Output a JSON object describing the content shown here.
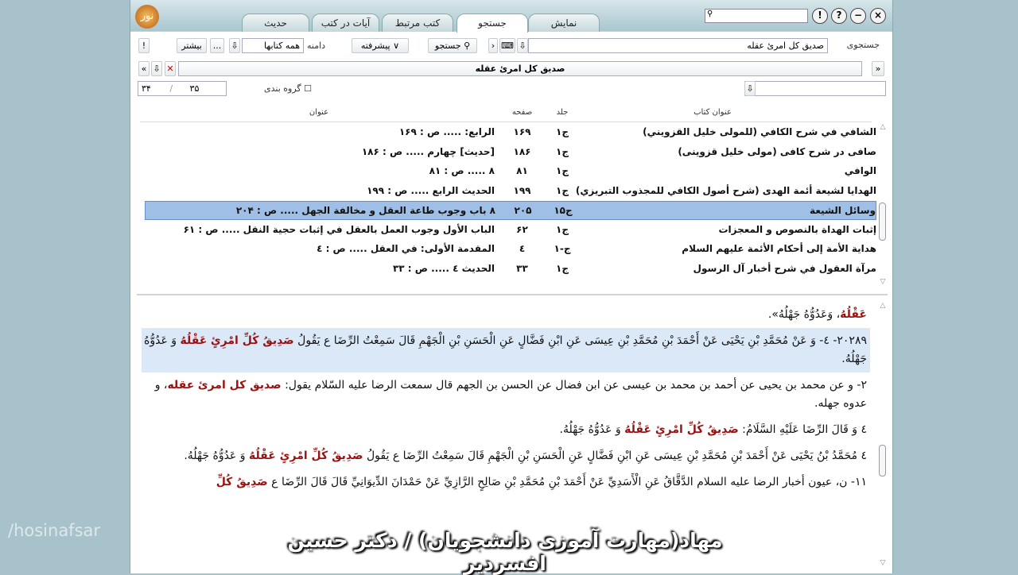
{
  "window": {
    "logo": "نور",
    "tabs": [
      "نمایش",
      "جستجو",
      "کتب مرتبط",
      "آیات در کتب",
      "حدیث"
    ],
    "active_tab": "جستجو",
    "controls": [
      "!",
      "?",
      "−",
      "×"
    ]
  },
  "toolbar": {
    "search_label": "جستجوی",
    "search_value": "صديق كل امرئ عقله",
    "search_button": "جستجو",
    "advanced_button": "پیشرفته",
    "scope_label": "دامنه",
    "scope_value": "همه کتابها",
    "more_dots": "...",
    "more_button": "بیشتر",
    "info": "!"
  },
  "filter_bar": {
    "query": "صديق كل امرئ عقله"
  },
  "paging": {
    "current": "۳۵",
    "separator": "/",
    "total": "۳۴",
    "grouping_label": "گروه بندی"
  },
  "table": {
    "headers": {
      "book": "عنوان کتاب",
      "volume": "جلد",
      "page": "صفحه",
      "title": "عنوان"
    },
    "rows": [
      {
        "book": "الشافي في شرح الكافي (للمولى خليل القزويني)",
        "volume": "ج۱",
        "page": "۱۶۹",
        "title": "الرابع: ..... ص : ۱۶۹"
      },
      {
        "book": "صافی در شرح کافی (مولی خلیل قزوینی)",
        "volume": "ج۱",
        "page": "۱۸۶",
        "title": "[حديث] چهارم ..... ص : ۱۸۶"
      },
      {
        "book": "الوافي",
        "volume": "ج۱",
        "page": "۸۱",
        "title": "۸ ..... ص : ۸۱"
      },
      {
        "book": "الهدايا لشيعة أئمة الهدى (شرح أصول الكافي للمجذوب التبريزي)",
        "volume": "ج۱",
        "page": "۱۹۹",
        "title": "الحديث الرابع ..... ص : ۱۹۹"
      },
      {
        "book": "وسائل الشيعة",
        "volume": "ج۱۵",
        "page": "۲۰۵",
        "title": "۸ باب وجوب طاعة العقل و مخالفة الجهل ..... ص : ۲۰۴"
      },
      {
        "book": "إثبات الهداة بالنصوص و المعجزات",
        "volume": "ج۱",
        "page": "۶۲",
        "title": "الباب الأول وجوب العمل بالعقل في إثبات حجية النقل ..... ص : ۶۱"
      },
      {
        "book": "هداية الأمة إلى أحكام الأئمة عليهم السلام",
        "volume": "ج-۱",
        "page": "٤",
        "title": "المقدمة الأولى: في العقل ..... ص : ٤"
      },
      {
        "book": "مرآة العقول في شرح أخبار آل الرسول",
        "volume": "ج۱",
        "page": "۳۳",
        "title": "الحديث ٤ ..... ص : ۳۳"
      }
    ],
    "selected_index": 4
  },
  "content": {
    "l1a": "عَقْلُهُ",
    "l1b": "، وَعَدُوُّهُ جَهْلُهُ».",
    "l2a": "۲۰۲۸۹- ٤- وَ عَنْ مُحَمَّدِ بْنِ يَحْيَى عَنْ أَحْمَدَ بْنِ مُحَمَّدِ بْنِ عِيسَى عَنِ ابْنِ فَضَّالٍ عَنِ الْحَسَنِ بْنِ الْجَهْمِ قَالَ سَمِعْتُ الرِّضَا ع يَقُولُ ",
    "l2b": "صَدِيقُ كُلِّ امْرِئٍ",
    "l3a": "عَقْلُهُ",
    "l3b": " وَ عَدُوُّهُ جَهْلُهُ.",
    "l4a": "۲- و عن محمد بن يحيى عن أحمد بن محمد بن عيسى عن ابن فضال عن الحسن بن الجهم قال سمعت الرضا عليه السّلام يقول: ",
    "l4b": "صديق كل امرئ",
    "l5a": "عقله",
    "l5b": "، و عدوه جهله.",
    "l6a": "٤ وَ قَالَ الرِّضَا عَلَيْهِ السَّلَامُ: ",
    "l6b": "صَدِيقُ كُلِّ امْرِئٍ عَقْلُهُ",
    "l6c": " وَ عَدُوُّهُ جَهْلُهُ.",
    "l7a": "٤ مُحَمَّدُ بْنُ يَحْيَى عَنْ أَحْمَدَ بْنِ مُحَمَّدِ بْنِ عِيسَى عَنِ ابْنِ فَضَّالٍ عَنِ الْحَسَنِ بْنِ الْجَهْمِ قَالَ سَمِعْتُ الرِّضَا ع يَقُولُ ",
    "l7b": "صَدِيقُ كُلِّ امْرِئٍ عَقْلُهُ",
    "l7c": " وَ عَدُوُّهُ جَهْلُهُ.",
    "l8a": "۱۱- ن، عيون أخبار الرضا عليه السلام الدَّقَّاقُ عَنِ الْأَسَدِيِّ عَنْ أَحْمَدَ بْنِ مُحَمَّدِ بْنِ صَالِحٍ الرَّازِيِّ عَنْ حَمْدَانَ الدِّيوَانِيِّ قَالَ قَالَ الرِّضَا ع ",
    "l8b": "صَدِيقُ كُلِّ"
  },
  "overlay_caption": "مهاد(مهارت آموزی دانشجویان) / دکتر حسین افسردیر",
  "watermark": "/hosinafsar"
}
